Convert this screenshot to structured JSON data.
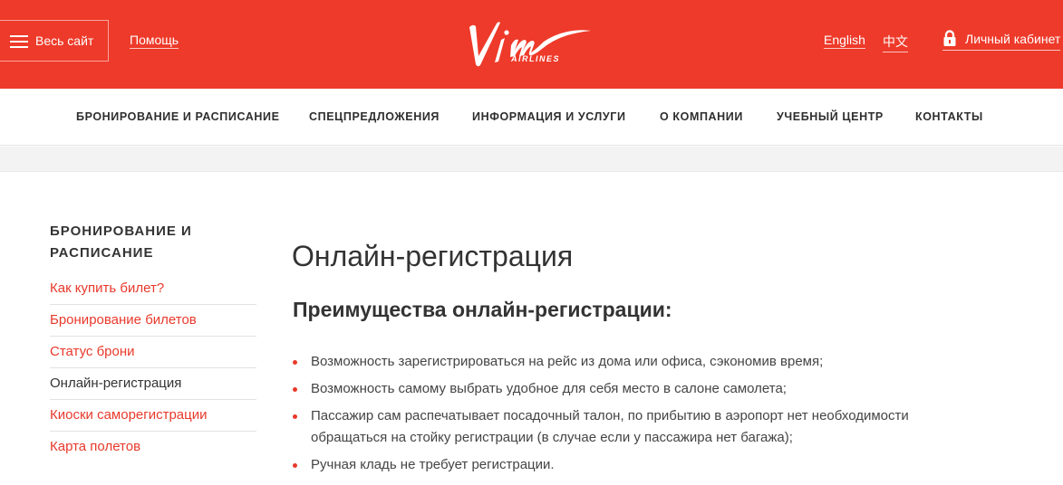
{
  "header": {
    "menu_label": "Весь сайт",
    "help_label": "Помощь",
    "logo_text": "Vim AIRLINES",
    "lang_en": "English",
    "lang_zh": "中文",
    "cabinet_label": "Личный кабинет"
  },
  "nav": {
    "items": [
      {
        "label": "БРОНИРОВАНИЕ И РАСПИСАНИЕ"
      },
      {
        "label": "СПЕЦПРЕДЛОЖЕНИЯ"
      },
      {
        "label": "ИНФОРМАЦИЯ И УСЛУГИ"
      },
      {
        "label": "О КОМПАНИИ"
      },
      {
        "label": "УЧЕБНЫЙ ЦЕНТР"
      },
      {
        "label": "КОНТАКТЫ"
      }
    ]
  },
  "sidebar": {
    "heading_line1": "БРОНИРОВАНИЕ И",
    "heading_line2": "РАСПИСАНИЕ",
    "items": [
      {
        "label": "Как купить билет?"
      },
      {
        "label": "Бронирование билетов"
      },
      {
        "label": "Статус брони"
      },
      {
        "label": "Онлайн-регистрация"
      },
      {
        "label": "Киоски саморегистрации"
      },
      {
        "label": "Карта полетов"
      }
    ]
  },
  "main": {
    "title": "Онлайн-регистрация",
    "subtitle": "Преимущества онлайн-регистрации:",
    "benefits": [
      "Возможность зарегистрироваться на рейс из дома или офиса, сэкономив время;",
      "Возможность самому выбрать удобное для себя место в салоне самолета;",
      "Пассажир сам распечатывает посадочный талон, по прибытию в аэропорт нет необходимости обращаться на стойку регистрации (в случае если у пассажира нет багажа);",
      "Ручная кладь не требует регистрации."
    ]
  },
  "colors": {
    "brand_red": "#ee3a2a",
    "link_red": "#e8392b",
    "text_dark": "#333333"
  },
  "icons": {
    "menu": "hamburger-icon",
    "lock": "lock-icon",
    "bullet": "bullet-dot-icon"
  }
}
